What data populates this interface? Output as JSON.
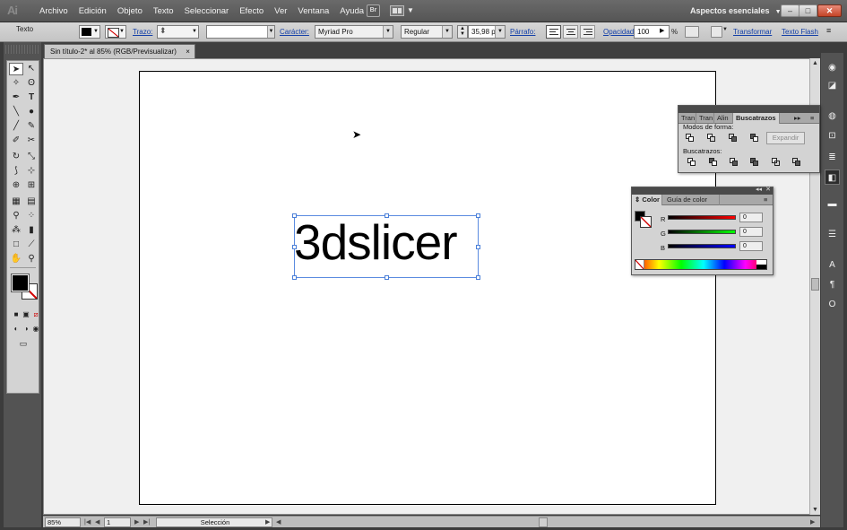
{
  "app": {
    "logo": "Ai",
    "menu": [
      "Archivo",
      "Edición",
      "Objeto",
      "Texto",
      "Seleccionar",
      "Efecto",
      "Ver",
      "Ventana",
      "Ayuda"
    ],
    "bridge_label": "Br",
    "workspace": "Aspectos esenciales",
    "window_buttons": {
      "minimize": "–",
      "maximize": "□",
      "close": "✕"
    }
  },
  "control_bar": {
    "tool_name": "Texto",
    "stroke_label": "Trazo:",
    "character_label": "Carácter:",
    "font_family": "Myriad Pro",
    "font_style": "Regular",
    "font_size": "35,98 pt",
    "paragraph_label": "Párrafo:",
    "opacity_label": "Opacidad:",
    "opacity_value": "100",
    "opacity_unit": "%",
    "transform_label": "Transformar",
    "text_flash_label": "Texto Flash"
  },
  "document": {
    "tab_title": "Sin título-2* al 85% (RGB/Previsualizar)",
    "tab_close": "×",
    "artwork_text": "3dslicer"
  },
  "status_bar": {
    "zoom": "85%",
    "artboard_number": "1",
    "current_tool": "Selección"
  },
  "pathfinder_panel": {
    "tabs": [
      "Tran",
      "Tran",
      "Alin",
      "Buscatrazos"
    ],
    "active_tab": "Buscatrazos",
    "shape_modes_label": "Modos de forma:",
    "expand_button": "Expandir",
    "pathfinders_label": "Buscatrazos:"
  },
  "color_panel": {
    "tabs": [
      "Color",
      "Guía de color"
    ],
    "active_tab": "Color",
    "channels": [
      {
        "label": "R",
        "value": "0",
        "color": "#d10000"
      },
      {
        "label": "G",
        "value": "0",
        "color": "#00a000"
      },
      {
        "label": "B",
        "value": "0",
        "color": "#0010d0"
      }
    ]
  },
  "colors": {
    "selection_blue": "#4a7fd8",
    "fill": "#000000",
    "stroke_none_red": "#d10000"
  }
}
